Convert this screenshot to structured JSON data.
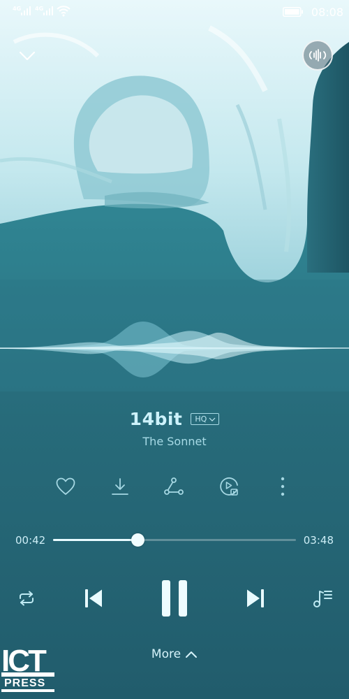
{
  "status_bar": {
    "network1": "4G",
    "network2": "4G",
    "time": "08:08"
  },
  "song": {
    "title": "14bit",
    "quality": "HQ",
    "artist": "The Sonnet"
  },
  "progress": {
    "current": "00:42",
    "total": "03:48",
    "fraction": 0.35
  },
  "more_label": "More",
  "watermark": {
    "top": "ICT",
    "bottom": "PRESS"
  },
  "icons": {
    "collapse": "chevron-down-icon",
    "sound_effect": "sound-effect-icon",
    "like": "heart-icon",
    "download": "download-icon",
    "share": "share-icon",
    "video": "video-play-icon",
    "more_options": "more-vertical-icon",
    "repeat": "repeat-icon",
    "previous": "previous-icon",
    "pause": "pause-icon",
    "next": "next-icon",
    "playlist": "playlist-icon"
  },
  "colors": {
    "accent": "#cdf2fb",
    "background": "#276b7a"
  }
}
